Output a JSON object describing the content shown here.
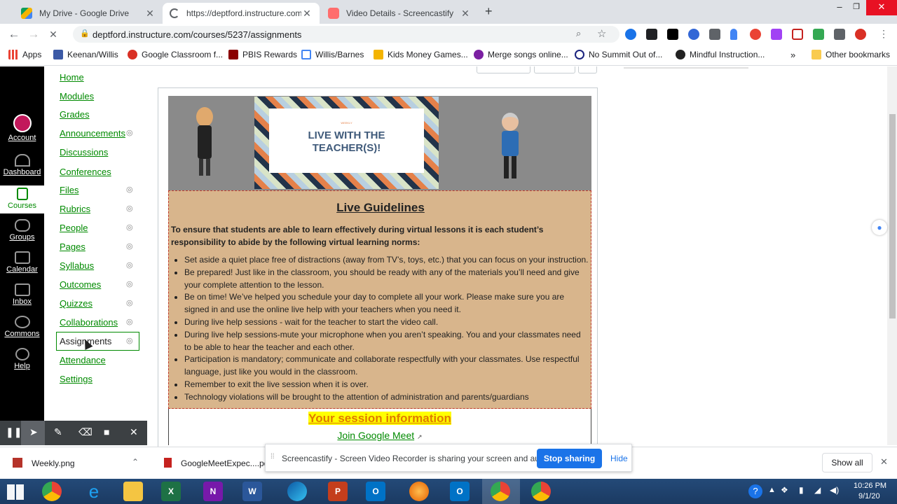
{
  "tabs": [
    {
      "title": "My Drive - Google Drive"
    },
    {
      "title": "https://deptford.instructure.com/"
    },
    {
      "title": "Video Details - Screencastify"
    }
  ],
  "window_controls": {
    "minimize": "–",
    "restore": "❐",
    "close": "✕"
  },
  "address_bar": {
    "url": "deptford.instructure.com/courses/5237/assignments"
  },
  "bookmarks": [
    "Apps",
    "Keenan/Willis",
    "Google Classroom f...",
    "PBIS Rewards",
    "Willis/Barnes",
    "Kids Money Games...",
    "Merge songs online...",
    "No Summit Out of...",
    "Mindful Instruction...",
    "Other bookmarks"
  ],
  "global_nav": [
    {
      "label": "Account",
      "icon": "account-icon"
    },
    {
      "label": "Dashboard",
      "icon": "dashboard-icon"
    },
    {
      "label": "Courses",
      "icon": "courses-icon"
    },
    {
      "label": "Groups",
      "icon": "groups-icon"
    },
    {
      "label": "Calendar",
      "icon": "calendar-icon"
    },
    {
      "label": "Inbox",
      "icon": "inbox-icon"
    },
    {
      "label": "Commons",
      "icon": "commons-icon"
    },
    {
      "label": "Help",
      "icon": "help-icon"
    }
  ],
  "course_nav": [
    "Home",
    "Modules",
    "Grades",
    "Announcements",
    "Discussions",
    "Conferences",
    "Files",
    "Rubrics",
    "People",
    "Pages",
    "Syllabus",
    "Outcomes",
    "Quizzes",
    "Collaborations",
    "Assignments",
    "Attendance",
    "Settings"
  ],
  "banner": {
    "small": "WEEKLY",
    "title": "LIVE WITH THE TEACHER(S)!"
  },
  "guidelines": {
    "heading": "Live Guidelines",
    "intro": "To ensure that students are able to learn effectively during virtual lessons it is each student’s responsibility to abide by the following virtual learning norms:",
    "items": [
      "Set aside a quiet place free of distractions (away from TV’s, toys, etc.) that you can focus on your instruction.",
      "Be prepared! Just like in the classroom, you should be ready with any of the materials you’ll need and give your complete attention to the lesson.",
      "Be on time! We’ve helped you schedule your day to complete all your work. Please make sure you are signed in and use the online live help with your teachers when you need it.",
      "During live help sessions - wait for the teacher to start the video call.",
      "During live help sessions-mute your microphone when you aren’t speaking. You and your classmates need to be able to hear the teacher and each other.",
      "Participation is mandatory; communicate and collaborate respectfully with your classmates. Use respectful language, just like you would in the classroom.",
      "Remember to exit the live session when it is over.",
      "Technology violations will be brought to the attention of administration and parents/guardians"
    ]
  },
  "session": {
    "heading": "Your session information",
    "link": "Join Google Meet"
  },
  "screencastify": {
    "message": "Screencastify - Screen Video Recorder is sharing your screen and audio.",
    "stop": "Stop sharing",
    "hide": "Hide"
  },
  "downloads": {
    "file1": "Weekly.png",
    "file2": "GoogleMeetExpec....pdf",
    "show_all": "Show all"
  },
  "clock": {
    "time": "10:26 PM",
    "date": "9/1/20"
  },
  "colors": {
    "canvas_link": "#008a00",
    "banner_gray": "#8a8a8a",
    "guidelines_bg": "#d8b58c",
    "highlight": "#ffff00",
    "stop_button": "#1a73e8"
  }
}
